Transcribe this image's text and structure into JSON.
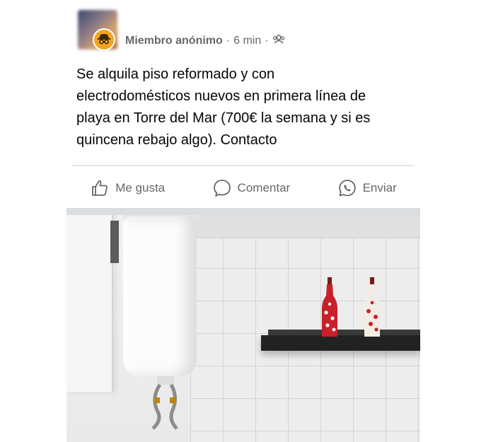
{
  "post": {
    "author_name": "Miembro anónimo",
    "time": "6 min",
    "separator": "·",
    "privacy_icon": "group-icon",
    "badge_icon": "anonymous-member-icon",
    "text_lines": [
      "Se alquila piso reformado y con",
      "electrodomésticos nuevos en primera línea de",
      "playa en Torre del Mar (700€ la semana y si es",
      "quincena rebajo algo). Contacto"
    ]
  },
  "actions": {
    "like_label": "Me gusta",
    "comment_label": "Comentar",
    "share_label": "Enviar",
    "like_icon": "thumbs-up-icon",
    "comment_icon": "speech-bubble-icon",
    "share_icon": "whatsapp-icon"
  },
  "colors": {
    "secondary_text": "#65676b",
    "anon_badge": "#f0a623",
    "divider": "#e4e6eb"
  }
}
